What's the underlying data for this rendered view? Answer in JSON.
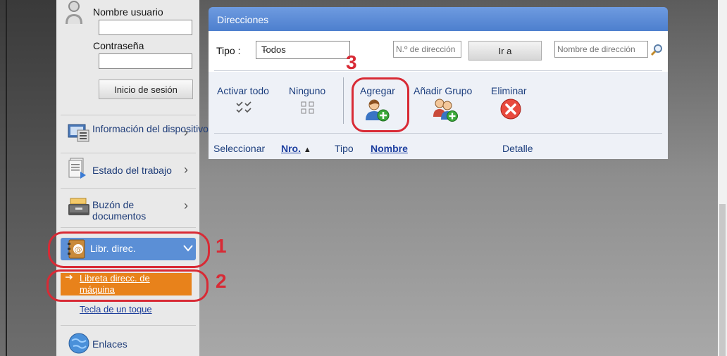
{
  "login": {
    "username_label": "Nombre usuario",
    "password_label": "Contraseña",
    "username_value": "",
    "password_value": "",
    "login_button": "Inicio de sesión"
  },
  "nav": {
    "device_info": "Información del dispositivo",
    "job_status": "Estado del trabajo",
    "document_box": "Buzón de documentos",
    "address_book": "Libr. direc.",
    "machine_address_book": "Libreta direcc. de máquina",
    "one_touch_key": "Tecla de un toque",
    "links": "Enlaces"
  },
  "panel": {
    "title": "Direcciones",
    "type_label": "Tipo :",
    "type_selected": "Todos",
    "address_number_placeholder": "N.º de dirección",
    "go_button": "Ir a",
    "address_name_placeholder": "Nombre de dirección"
  },
  "toolbar": {
    "select_all": "Activar todo",
    "select_none": "Ninguno",
    "add": "Agregar",
    "add_group": "Añadir Grupo",
    "delete": "Eliminar"
  },
  "table": {
    "columns": [
      "Seleccionar",
      "Nro.",
      "Tipo",
      "Nombre",
      "Detalle"
    ]
  },
  "callouts": {
    "one": "1",
    "two": "2",
    "three": "3"
  },
  "colors": {
    "accent_blue": "#5b8fd6",
    "active_orange": "#e8821b",
    "callout_red": "#d82a35"
  }
}
